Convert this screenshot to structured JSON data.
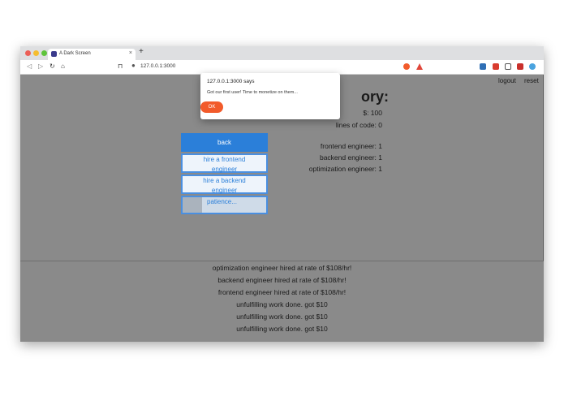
{
  "browser": {
    "tab_title": "A Dark Screen",
    "tab_close": "×",
    "new_tab": "+",
    "url": "127.0.0.1:3000"
  },
  "top_links": {
    "logout": "logout",
    "reset": "reset"
  },
  "story": {
    "heading": "ory:",
    "money": "$: 100",
    "lines_of_code": "lines of code: 0",
    "frontend_engineer": "frontend engineer: 1",
    "backend_engineer": "backend engineer: 1",
    "optimization_engineer": "optimization engineer: 1"
  },
  "actions": {
    "back": "back",
    "hire_frontend_1": "hire a frontend",
    "hire_frontend_2": "engineer",
    "hire_backend_1": "hire a backend",
    "hire_backend_2": "engineer",
    "patience": "patience...",
    "patience_progress": 0.23
  },
  "log": [
    "optimization engineer hired at rate of $108/hr!",
    "backend engineer hired at rate of $108/hr!",
    "frontend engineer hired at rate of $108/hr!",
    "unfulfilling work done. got $10",
    "unfulfilling work done. got $10",
    "unfulfilling work done. got $10"
  ],
  "dialog": {
    "title": "127.0.0.1:3000 says",
    "message": "Got our first user! Time to monetize on them...",
    "ok": "OK"
  },
  "colors": {
    "accent": "#2b7fd9",
    "ok_button": "#f25b2b",
    "background": "#8a8a8a"
  }
}
